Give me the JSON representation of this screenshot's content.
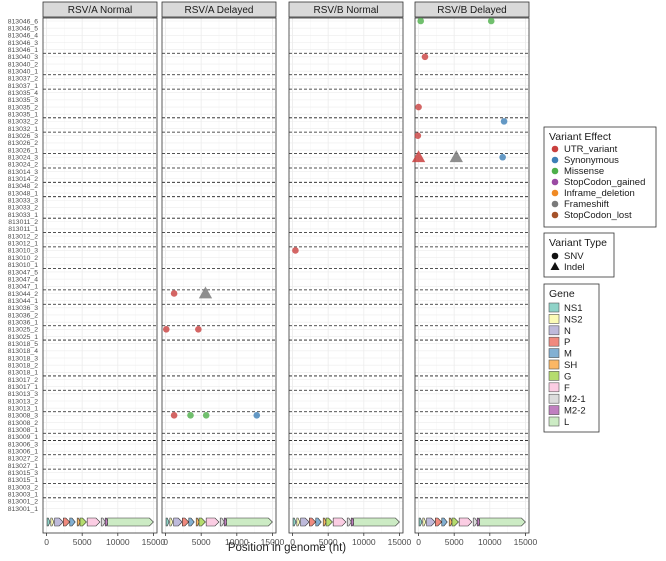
{
  "chart_data": {
    "type": "scatter",
    "xlabel": "Position in genome (nt)",
    "ylabel": "",
    "xlim": [
      -500,
      15500
    ],
    "x_ticks": [
      0,
      5000,
      10000,
      15000
    ],
    "x_tick_labels": [
      "0",
      "5000",
      "10000",
      "15000"
    ],
    "grid": true,
    "facets": [
      "RSV/A Normal",
      "RSV/A Delayed",
      "RSV/B Normal",
      "RSV/B Delayed"
    ],
    "samples": [
      "813046_6",
      "813046_5",
      "813046_4",
      "813046_3",
      "813046_1",
      "813040_3",
      "813040_2",
      "813040_1",
      "813037_2",
      "813037_1",
      "813035_4",
      "813035_3",
      "813035_2",
      "813035_1",
      "813032_2",
      "813032_1",
      "813026_3",
      "813026_2",
      "813026_1",
      "813024_3",
      "813024_2",
      "813014_3",
      "813014_2",
      "813048_2",
      "813048_1",
      "813033_3",
      "813033_2",
      "813033_1",
      "813011_2",
      "813011_1",
      "813012_2",
      "813012_1",
      "813010_3",
      "813010_2",
      "813010_1",
      "813047_5",
      "813047_4",
      "813047_1",
      "813044_2",
      "813044_1",
      "813036_3",
      "813036_2",
      "813036_1",
      "813025_2",
      "813025_1",
      "813018_5",
      "813018_4",
      "813018_3",
      "813018_2",
      "813018_1",
      "813017_2",
      "813017_1",
      "813013_3",
      "813013_2",
      "813013_1",
      "813008_3",
      "813008_2",
      "813008_1",
      "813009_1",
      "813006_3",
      "813006_1",
      "813027_2",
      "813027_1",
      "813015_3",
      "813015_1",
      "813003_2",
      "813003_1",
      "813001_2",
      "813001_1"
    ],
    "group_separators_after": [
      "813046_1",
      "813040_1",
      "813037_1",
      "813035_1",
      "813032_1",
      "813026_1",
      "813024_2",
      "813014_2",
      "813048_1",
      "813033_1",
      "813011_1",
      "813012_1",
      "813010_1",
      "813047_1",
      "813044_1",
      "813036_1",
      "813025_1",
      "813018_1",
      "813017_1",
      "813013_1",
      "813008_1",
      "813009_1",
      "813006_1",
      "813027_1",
      "813015_1",
      "813003_1"
    ],
    "legends": [
      {
        "title": "Variant Effect",
        "entries": [
          "UTR_variant",
          "Synonymous",
          "Missense",
          "StopCodon_gained",
          "Inframe_deletion",
          "Frameshift",
          "StopCodon_lost"
        ],
        "colors": [
          "#c9403e",
          "#3d7fb6",
          "#4db04a",
          "#9a4aa3",
          "#f08a24",
          "#7a7a7a",
          "#a5522a"
        ]
      },
      {
        "title": "Variant Type",
        "entries": [
          "SNV",
          "Indel"
        ],
        "shapes": [
          "circle",
          "triangle"
        ]
      },
      {
        "title": "Gene",
        "entries": [
          "NS1",
          "NS2",
          "N",
          "P",
          "M",
          "SH",
          "G",
          "F",
          "M2-1",
          "M2-2",
          "L"
        ],
        "colors": [
          "#8fd3c8",
          "#fbfbb6",
          "#bebadb",
          "#f08a7e",
          "#82b0d3",
          "#fbb765",
          "#b5dc6e",
          "#fbcde3",
          "#dcdcdc",
          "#c07fc0",
          "#ccebc4"
        ]
      }
    ],
    "genes": [
      {
        "name": "NS1",
        "start": 70,
        "end": 490
      },
      {
        "name": "NS2",
        "start": 600,
        "end": 1000
      },
      {
        "name": "N",
        "start": 1140,
        "end": 2340
      },
      {
        "name": "P",
        "start": 2350,
        "end": 3250
      },
      {
        "name": "M",
        "start": 3260,
        "end": 4030
      },
      {
        "name": "SH",
        "start": 4300,
        "end": 4500
      },
      {
        "name": "G",
        "start": 4690,
        "end": 5600
      },
      {
        "name": "F",
        "start": 5700,
        "end": 7500
      },
      {
        "name": "M2-1",
        "start": 7670,
        "end": 8250
      },
      {
        "name": "M2-2",
        "start": 8230,
        "end": 8500
      },
      {
        "name": "L",
        "start": 8560,
        "end": 15000
      }
    ],
    "points": [
      {
        "facet": "RSV/A Delayed",
        "sample": "813044_2",
        "x": 1200,
        "effect": "UTR_variant",
        "type": "SNV"
      },
      {
        "facet": "RSV/A Delayed",
        "sample": "813044_2",
        "x": 5600,
        "effect": "Frameshift",
        "type": "Indel"
      },
      {
        "facet": "RSV/A Delayed",
        "sample": "813025_2",
        "x": 100,
        "effect": "UTR_variant",
        "type": "SNV"
      },
      {
        "facet": "RSV/A Delayed",
        "sample": "813025_2",
        "x": 4600,
        "effect": "UTR_variant",
        "type": "SNV"
      },
      {
        "facet": "RSV/A Delayed",
        "sample": "813008_3",
        "x": 1200,
        "effect": "UTR_variant",
        "type": "SNV"
      },
      {
        "facet": "RSV/A Delayed",
        "sample": "813008_3",
        "x": 3500,
        "effect": "Missense",
        "type": "SNV"
      },
      {
        "facet": "RSV/A Delayed",
        "sample": "813008_3",
        "x": 5700,
        "effect": "Missense",
        "type": "SNV"
      },
      {
        "facet": "RSV/A Delayed",
        "sample": "813008_3",
        "x": 12800,
        "effect": "Synonymous",
        "type": "SNV"
      },
      {
        "facet": "RSV/B Normal",
        "sample": "813010_3",
        "x": 400,
        "effect": "UTR_variant",
        "type": "SNV"
      },
      {
        "facet": "RSV/B Delayed",
        "sample": "813046_6",
        "x": 300,
        "effect": "Missense",
        "type": "SNV"
      },
      {
        "facet": "RSV/B Delayed",
        "sample": "813046_6",
        "x": 10200,
        "effect": "Missense",
        "type": "SNV"
      },
      {
        "facet": "RSV/B Delayed",
        "sample": "813040_3",
        "x": 900,
        "effect": "UTR_variant",
        "type": "SNV"
      },
      {
        "facet": "RSV/B Delayed",
        "sample": "813035_2",
        "x": 0,
        "effect": "UTR_variant",
        "type": "SNV"
      },
      {
        "facet": "RSV/B Delayed",
        "sample": "813032_2",
        "x": 12000,
        "effect": "Synonymous",
        "type": "SNV"
      },
      {
        "facet": "RSV/B Delayed",
        "sample": "813026_3",
        "x": -100,
        "effect": "UTR_variant",
        "type": "SNV"
      },
      {
        "facet": "RSV/B Delayed",
        "sample": "813024_3",
        "x": 0,
        "effect": "UTR_variant",
        "type": "Indel"
      },
      {
        "facet": "RSV/B Delayed",
        "sample": "813024_3",
        "x": 5300,
        "effect": "Frameshift",
        "type": "Indel"
      },
      {
        "facet": "RSV/B Delayed",
        "sample": "813024_3",
        "x": 11800,
        "effect": "Synonymous",
        "type": "SNV"
      }
    ]
  }
}
